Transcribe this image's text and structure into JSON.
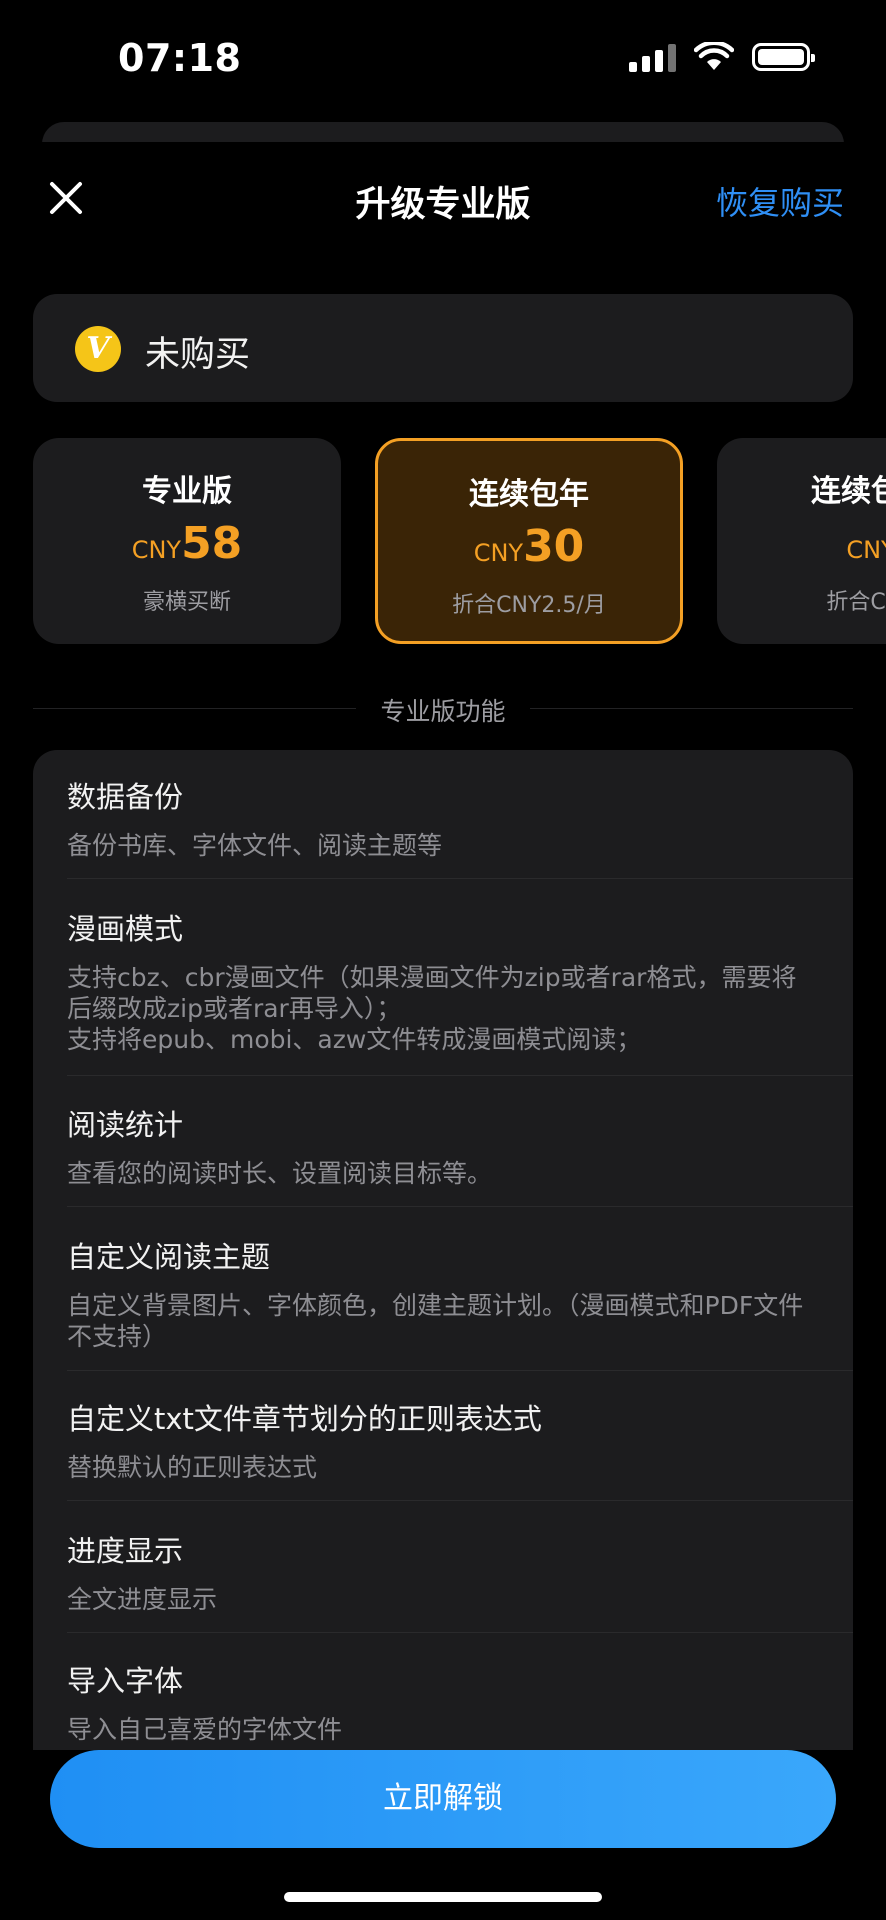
{
  "status_bar": {
    "time": "07:18"
  },
  "nav": {
    "title": "升级专业版",
    "restore_label": "恢复购买"
  },
  "purchase_status": {
    "badge": "V",
    "text": "未购买"
  },
  "plans": [
    {
      "name": "专业版",
      "currency": "CNY",
      "price": "58",
      "sub": "豪横买断",
      "selected": false
    },
    {
      "name": "连续包年",
      "currency": "CNY",
      "price": "30",
      "sub": "折合CNY2.5/月",
      "selected": true
    },
    {
      "name": "连续包月",
      "currency": "CNY",
      "price": "",
      "sub": "折合CNY",
      "selected": false
    }
  ],
  "section": {
    "title": "专业版功能"
  },
  "features": [
    {
      "title": "数据备份",
      "desc": "备份书库、字体文件、阅读主题等"
    },
    {
      "title": "漫画模式",
      "desc": "支持cbz、cbr漫画文件（如果漫画文件为zip或者rar格式，需要将后缀改成zip或者rar再导入）；\n支持将epub、mobi、azw文件转成漫画模式阅读；"
    },
    {
      "title": "阅读统计",
      "desc": "查看您的阅读时长、设置阅读目标等。"
    },
    {
      "title": "自定义阅读主题",
      "desc": "自定义背景图片、字体颜色，创建主题计划。（漫画模式和PDF文件不支持）"
    },
    {
      "title": "自定义txt文件章节划分的正则表达式",
      "desc": "替换默认的正则表达式"
    },
    {
      "title": "进度显示",
      "desc": "全文进度显示"
    },
    {
      "title": "导入字体",
      "desc": "导入自己喜爱的字体文件"
    }
  ],
  "cta": {
    "label": "立即解锁"
  },
  "colors": {
    "accent": "#f4a024",
    "link": "#2f8ff5",
    "button": "#2a9cf8",
    "card": "#1c1c1e"
  }
}
